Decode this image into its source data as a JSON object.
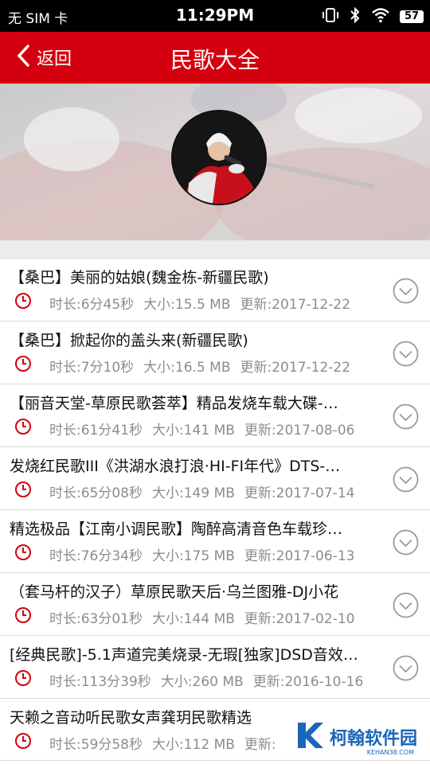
{
  "status_bar": {
    "carrier": "无 SIM 卡",
    "time": "11:29PM",
    "battery": "57"
  },
  "header": {
    "back_label": "返回",
    "title": "民歌大全"
  },
  "items": [
    {
      "title": "【桑巴】美丽的姑娘(魏金栋-新疆民歌)",
      "duration": "时长:6分45秒",
      "size": "大小:15.5 MB",
      "updated": "更新:2017-12-22"
    },
    {
      "title": "【桑巴】掀起你的盖头来(新疆民歌)",
      "duration": "时长:7分10秒",
      "size": "大小:16.5 MB",
      "updated": "更新:2017-12-22"
    },
    {
      "title": "【丽音天堂-草原民歌荟萃】精品发烧车载大碟-…",
      "duration": "时长:61分41秒",
      "size": "大小:141 MB",
      "updated": "更新:2017-08-06"
    },
    {
      "title": "发烧红民歌III《洪湖水浪打浪·HI-FI年代》DTS-…",
      "duration": "时长:65分08秒",
      "size": "大小:149 MB",
      "updated": "更新:2017-07-14"
    },
    {
      "title": "精选极品【江南小调民歌】陶醉高清音色车载珍…",
      "duration": "时长:76分34秒",
      "size": "大小:175 MB",
      "updated": "更新:2017-06-13"
    },
    {
      "title": "（套马杆的汉子）草原民歌天后·乌兰图雅-DJ小花",
      "duration": "时长:63分01秒",
      "size": "大小:144 MB",
      "updated": "更新:2017-02-10"
    },
    {
      "title": "[经典民歌]-5.1声道完美烧录-无瑕[独家]DSD音效…",
      "duration": "时长:113分39秒",
      "size": "大小:260 MB",
      "updated": "更新:2016-10-16"
    },
    {
      "title": "天赖之音动听民歌女声龚玥民歌精选",
      "duration": "时长:59分58秒",
      "size": "大小:112 MB",
      "updated": "更新:"
    }
  ],
  "watermark": {
    "text": "柯翰软件园",
    "sub": "KEHAN38.COM"
  },
  "colors": {
    "brand_red": "#d4000f",
    "meta_gray": "#8c8c8c",
    "clock_red": "#d4000f"
  }
}
